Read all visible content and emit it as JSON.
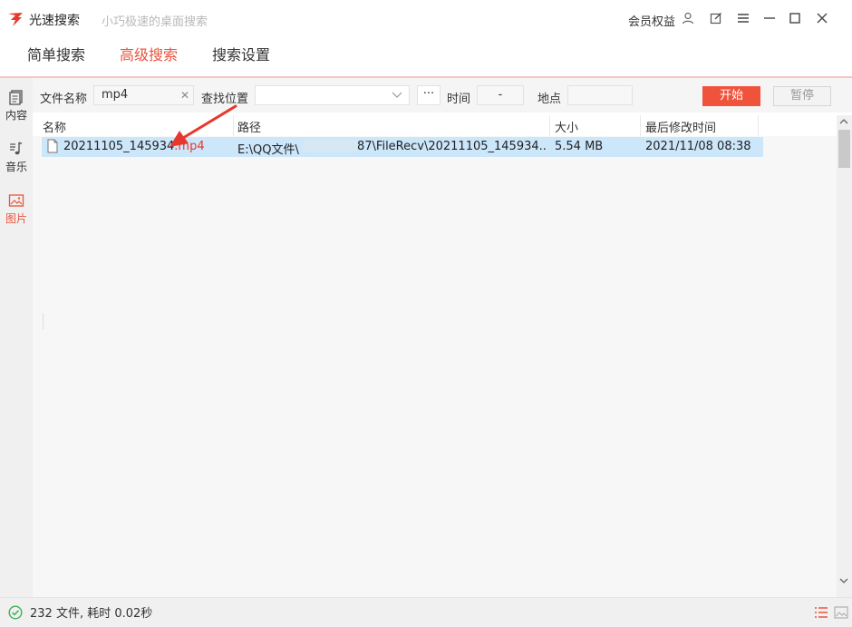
{
  "app": {
    "name": "光速搜索",
    "subtitle": "小巧极速的桌面搜索",
    "member_label": "会员权益"
  },
  "tabs": [
    {
      "label": "简单搜索",
      "active": false
    },
    {
      "label": "高级搜索",
      "active": true
    },
    {
      "label": "搜索设置",
      "active": false
    }
  ],
  "sidebar": [
    {
      "label": "内容",
      "icon": "document-icon",
      "active": false
    },
    {
      "label": "音乐",
      "icon": "music-icon",
      "active": false
    },
    {
      "label": "图片",
      "icon": "image-icon",
      "active": true
    }
  ],
  "filter": {
    "filename_label": "文件名称",
    "filename_value": "mp4",
    "location_label": "查找位置",
    "location_value": "",
    "more_label": "···",
    "time_label": "时间",
    "time_value": "-",
    "place_label": "地点",
    "place_value": "",
    "start_label": "开始",
    "pause_label": "暂停"
  },
  "table": {
    "columns": [
      "名称",
      "路径",
      "大小",
      "最后修改时间"
    ],
    "rows": [
      {
        "name_base": "20211105_145934",
        "name_ext": ".mp4",
        "path_prefix": "E:\\QQ文件\\",
        "path_suffix": "87\\FileRecv\\20211105_145934....",
        "size": "5.54 MB",
        "modified": "2021/11/08 08:38"
      }
    ]
  },
  "status": {
    "text": "232 文件, 耗时 0.02秒"
  },
  "colors": {
    "accent": "#e8553f",
    "start_button": "#f0533c",
    "selected_row": "#cce6fa",
    "annotation_arrow": "#e8372c"
  }
}
